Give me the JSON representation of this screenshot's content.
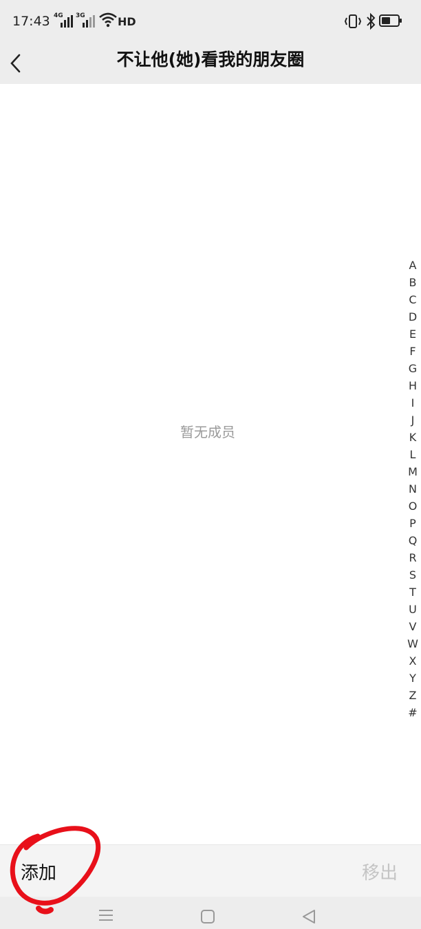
{
  "status_bar": {
    "time": "17:43",
    "network_1": "4G",
    "network_2": "3G",
    "wifi_label": "HD",
    "icons": [
      "signal-icon",
      "wifi-icon",
      "vibrate-icon",
      "bluetooth-icon",
      "battery-icon"
    ],
    "battery_level": 0.6
  },
  "header": {
    "title": "不让他(她)看我的朋友圈",
    "back_icon": "chevron-left-icon"
  },
  "main": {
    "empty_text": "暂无成员"
  },
  "index": [
    "A",
    "B",
    "C",
    "D",
    "E",
    "F",
    "G",
    "H",
    "I",
    "J",
    "K",
    "L",
    "M",
    "N",
    "O",
    "P",
    "Q",
    "R",
    "S",
    "T",
    "U",
    "V",
    "W",
    "X",
    "Y",
    "Z",
    "#"
  ],
  "bottom": {
    "add_label": "添加",
    "remove_label": "移出"
  },
  "nav": {
    "icons": [
      "menu-icon",
      "home-icon",
      "back-triangle-icon"
    ]
  },
  "colors": {
    "header_bg": "#ededed",
    "annotation": "#e8101a",
    "disabled_text": "#c4c4c4",
    "empty_text": "#9a9a9a"
  }
}
